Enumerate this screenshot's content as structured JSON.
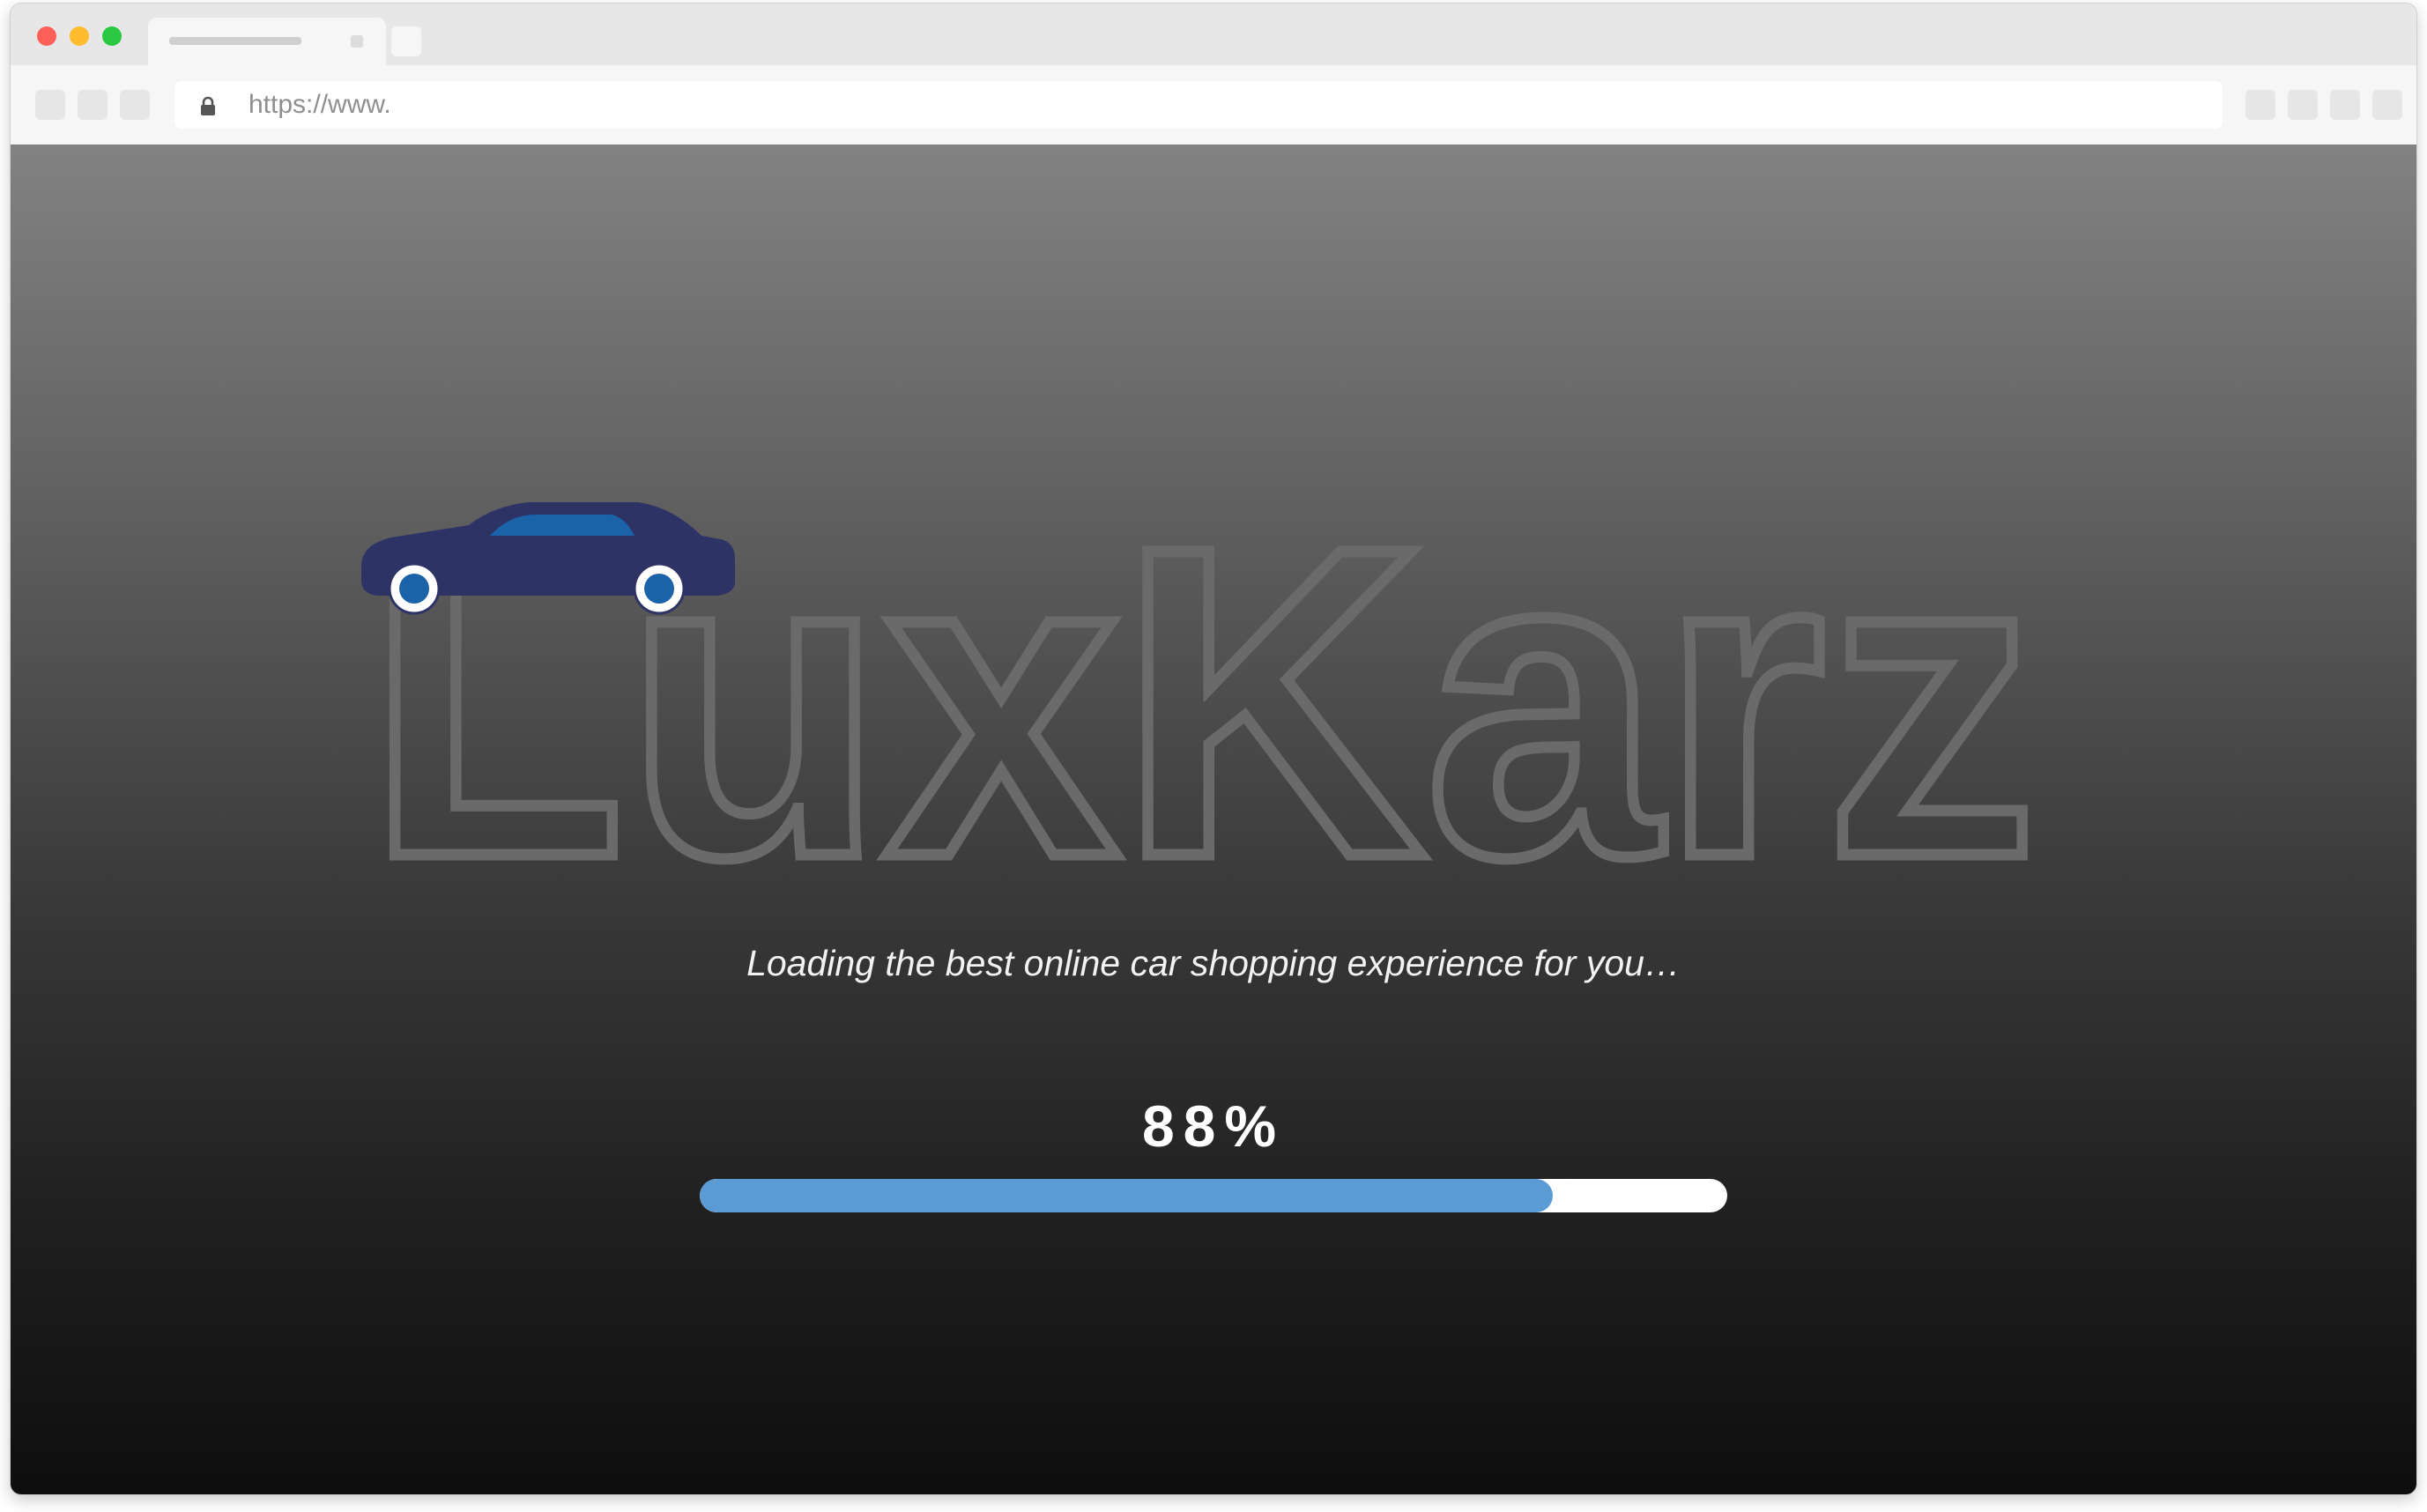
{
  "browser": {
    "url": "https://www."
  },
  "logo": {
    "text": "LuxKarz",
    "colors": {
      "outline": "#6a6a6a",
      "car_body": "#2e3366",
      "car_window": "#1a63a8",
      "wheel_hub": "#1a63a8",
      "wheel_rim": "#ffffff"
    }
  },
  "loading": {
    "message": "Loading the best online car shopping experience for you…",
    "percent_label": "88%",
    "progress": 0.83,
    "bar_color": "#5b9bd5",
    "track_color": "#ffffff"
  }
}
